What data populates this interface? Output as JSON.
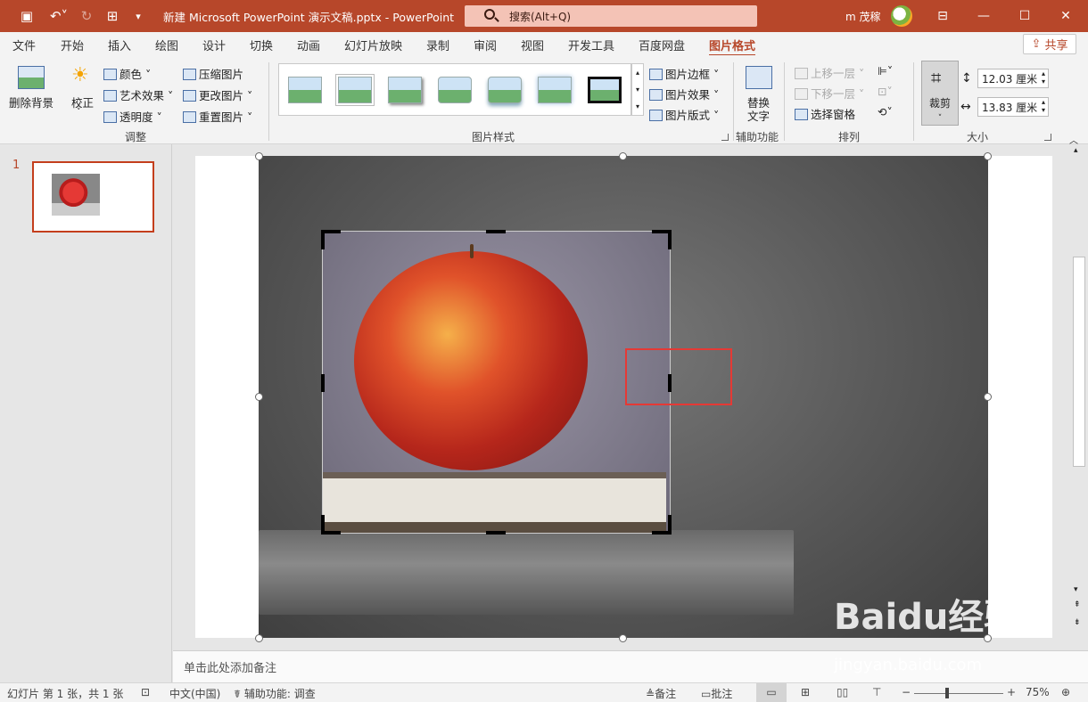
{
  "titlebar": {
    "title": "新建 Microsoft PowerPoint 演示文稿.pptx  -  PowerPoint",
    "search": "搜索(Alt+Q)",
    "user": "m 茂稼"
  },
  "menu": [
    "文件",
    "开始",
    "插入",
    "绘图",
    "设计",
    "切换",
    "动画",
    "幻灯片放映",
    "录制",
    "审阅",
    "视图",
    "开发工具",
    "百度网盘",
    "图片格式"
  ],
  "share": "共享",
  "ribbon": {
    "remove_bg": "删除背景",
    "correct": "校正",
    "color": "颜色",
    "artistic": "艺术效果",
    "transparency": "透明度",
    "compress": "压缩图片",
    "change": "更改图片",
    "reset": "重置图片",
    "group_adjust": "调整",
    "border": "图片边框",
    "effects": "图片效果",
    "layout": "图片版式",
    "group_styles": "图片样式",
    "alt_text_1": "替换",
    "alt_text_2": "文字",
    "group_access": "辅助功能",
    "bring_forward": "上移一层",
    "send_backward": "下移一层",
    "selection_pane": "选择窗格",
    "group_arrange": "排列",
    "crop": "裁剪",
    "height": "12.03 厘米",
    "width": "13.83 厘米",
    "group_size": "大小"
  },
  "slide_number": "1",
  "notes": "单击此处添加备注",
  "status": {
    "slide": "幻灯片 第 1 张，共 1 张",
    "lang": "中文(中国)",
    "access": "辅助功能: 调查",
    "notes": "备注",
    "comments": "批注",
    "zoom": "75%"
  },
  "watermark": {
    "logo": "Baidu经验",
    "url": "jingyan.baidu.com"
  }
}
